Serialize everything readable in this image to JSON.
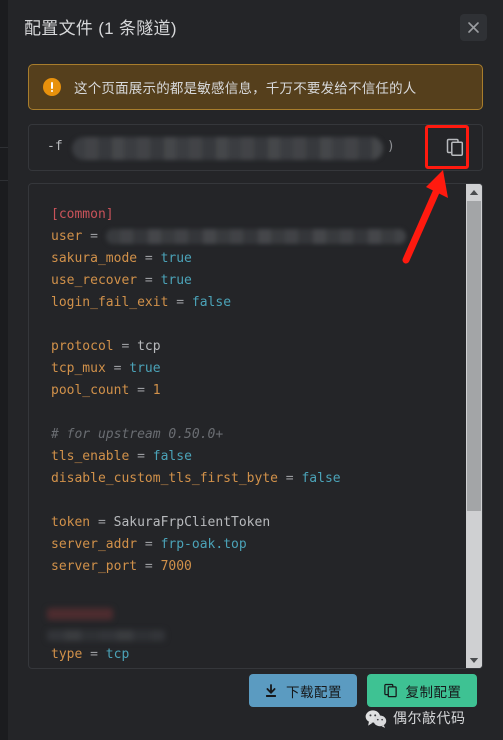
{
  "dialog": {
    "title": "配置文件 (1 条隧道)",
    "close_icon": "close-icon"
  },
  "warning": {
    "icon": "alert-circle-icon",
    "text": "这个页面展示的都是敏感信息，千万不要发给不信任的人"
  },
  "command": {
    "prefix": "-f",
    "suffix": ")",
    "redacted": true
  },
  "copy_icon_button": {
    "icon": "copy-icon",
    "highlighted": true
  },
  "code": {
    "lines": [
      {
        "type": "section",
        "text": "[common]"
      },
      {
        "type": "kv_redacted",
        "key": "user",
        "eq": "="
      },
      {
        "type": "kv",
        "key": "sakura_mode",
        "eq": "=",
        "value": "true",
        "value_kind": "bool"
      },
      {
        "type": "kv",
        "key": "use_recover",
        "eq": "=",
        "value": "true",
        "value_kind": "bool"
      },
      {
        "type": "kv",
        "key": "login_fail_exit",
        "eq": "=",
        "value": "false",
        "value_kind": "bool"
      },
      {
        "type": "blank"
      },
      {
        "type": "kv",
        "key": "protocol",
        "eq": "=",
        "value": "tcp",
        "value_kind": "str"
      },
      {
        "type": "kv",
        "key": "tcp_mux",
        "eq": "=",
        "value": "true",
        "value_kind": "bool"
      },
      {
        "type": "kv",
        "key": "pool_count",
        "eq": "=",
        "value": "1",
        "value_kind": "num"
      },
      {
        "type": "blank"
      },
      {
        "type": "comment",
        "text": "# for upstream 0.50.0+"
      },
      {
        "type": "kv",
        "key": "tls_enable",
        "eq": "=",
        "value": "false",
        "value_kind": "bool"
      },
      {
        "type": "kv",
        "key": "disable_custom_tls_first_byte",
        "eq": "=",
        "value": "false",
        "value_kind": "bool"
      },
      {
        "type": "blank"
      },
      {
        "type": "kv",
        "key": "token",
        "eq": "=",
        "value": "SakuraFrpClientToken",
        "value_kind": "str"
      },
      {
        "type": "kv",
        "key": "server_addr",
        "eq": "=",
        "value": "frp-oak.top",
        "value_kind": "val"
      },
      {
        "type": "kv",
        "key": "server_port",
        "eq": "=",
        "value": "7000",
        "value_kind": "num"
      },
      {
        "type": "blank"
      },
      {
        "type": "redacted_section"
      },
      {
        "type": "redacted_line"
      },
      {
        "type": "kv",
        "key": "type",
        "eq": "=",
        "value": "tcp",
        "value_kind": "val"
      }
    ]
  },
  "scrollbar": {
    "up_arrow_icon": "chevron-up-icon",
    "down_arrow_icon": "chevron-down-icon"
  },
  "footer": {
    "download_button": {
      "label": "下载配置",
      "icon": "download-icon",
      "color": "#5b9bc1"
    },
    "copy_button": {
      "label": "复制配置",
      "icon": "copy-icon",
      "color": "#3ec293"
    }
  },
  "watermark": {
    "icon": "wechat-icon",
    "text": "偶尔敲代码"
  },
  "annotation": {
    "color": "#ff1a0f",
    "shapes": [
      "highlight-rectangle",
      "pointer-arrow"
    ]
  }
}
